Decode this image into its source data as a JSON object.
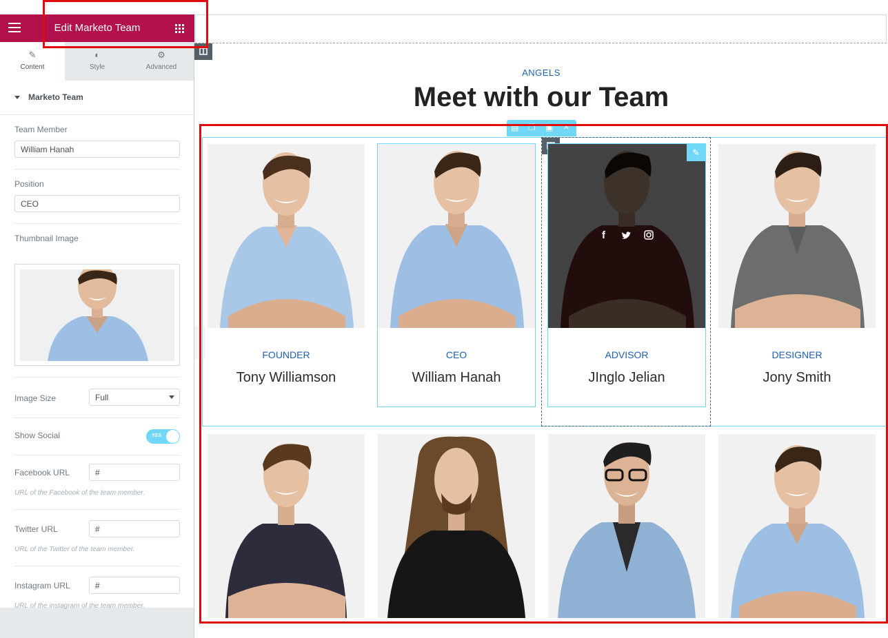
{
  "editor": {
    "title": "Edit Marketo Team",
    "tabs": [
      {
        "label": "Content",
        "icon": "pencil-icon"
      },
      {
        "label": "Style",
        "icon": "contrast-icon"
      },
      {
        "label": "Advanced",
        "icon": "gear-icon"
      }
    ],
    "section_title": "Marketo Team",
    "team_member_label": "Team Member",
    "team_member_value": "William Hanah",
    "position_label": "Position",
    "position_value": "CEO",
    "thumbnail_label": "Thumbnail Image",
    "image_size_label": "Image Size",
    "image_size_value": "Full",
    "show_social_label": "Show Social",
    "show_social_value": "YES",
    "facebook_label": "Facebook URL",
    "facebook_value": "#",
    "facebook_note": "URL of the Facebook of the team member.",
    "twitter_label": "Twitter URL",
    "twitter_value": "#",
    "twitter_note": "URL of the Twitter of the team member.",
    "instagram_label": "Instagram URL",
    "instagram_value": "#",
    "instagram_note": "URL of the instagram of the team member."
  },
  "page": {
    "eyebrow": "ANGELS",
    "heading": "Meet with our Team",
    "members": [
      {
        "position": "FOUNDER",
        "name": "Tony Williamson",
        "shirt": "#a9c8e8",
        "hair": "#4a2f1d"
      },
      {
        "position": "CEO",
        "name": "William Hanah",
        "shirt": "#9dbfe3",
        "hair": "#3a2616"
      },
      {
        "position": "ADVISOR",
        "name": "JInglo Jelian",
        "shirt": "#7a2f2f",
        "hair": "#2a1c12"
      },
      {
        "position": "DESIGNER",
        "name": "Jony Smith",
        "shirt": "#6b6e6c",
        "hair": "#2c1e14"
      }
    ],
    "row2": [
      {
        "shirt": "#2c2c3c",
        "hair": "#5a3a1e"
      },
      {
        "shirt": "#161616",
        "hair": "#6a4a2a"
      },
      {
        "shirt": "#8fb2d4",
        "hair": "#1e1e1e"
      },
      {
        "shirt": "#9dbfe3",
        "hair": "#3a2616"
      }
    ],
    "colors": {
      "accent": "#b3114b",
      "position_blue": "#1f5fb0",
      "selection": "#71d7f7",
      "highlight": "#e10b0b"
    }
  }
}
